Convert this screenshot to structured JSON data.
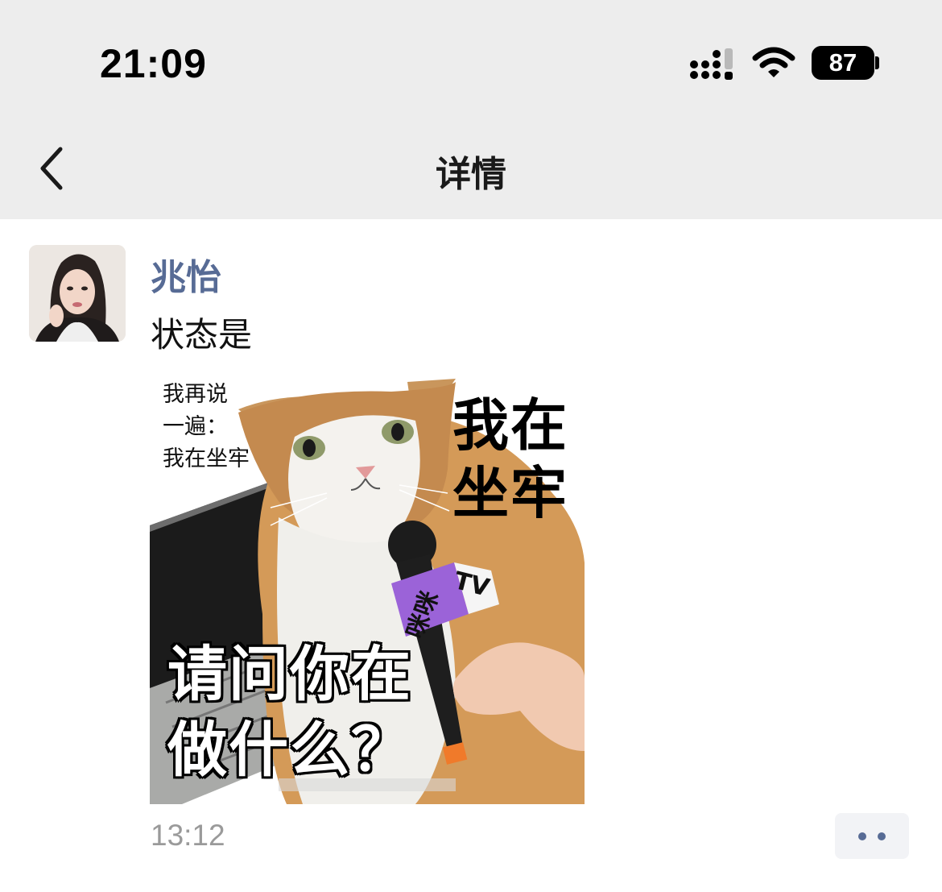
{
  "status_bar": {
    "time": "21:09",
    "battery": "87",
    "icons": [
      "cellular-signal-icon",
      "wifi-icon",
      "battery-icon"
    ]
  },
  "nav": {
    "title": "详情",
    "back_icon": "chevron-left-icon"
  },
  "post": {
    "author": "兆怡",
    "text": "状态是",
    "timestamp": "13:12",
    "more_icon": "more-dots-icon",
    "image": {
      "caption_small": [
        "我再说",
        "一遍：",
        "我在坐牢"
      ],
      "caption_big": [
        "我在",
        "坐牢"
      ],
      "caption_bottom": [
        "请问你在",
        "做什么？"
      ],
      "mic_label_left": "咪咪",
      "mic_label_right": "TV"
    }
  },
  "colors": {
    "header_bg": "#ededed",
    "author_link": "#576b95",
    "timestamp": "#9a9a9a",
    "mic_flag": "#9b63d8"
  }
}
